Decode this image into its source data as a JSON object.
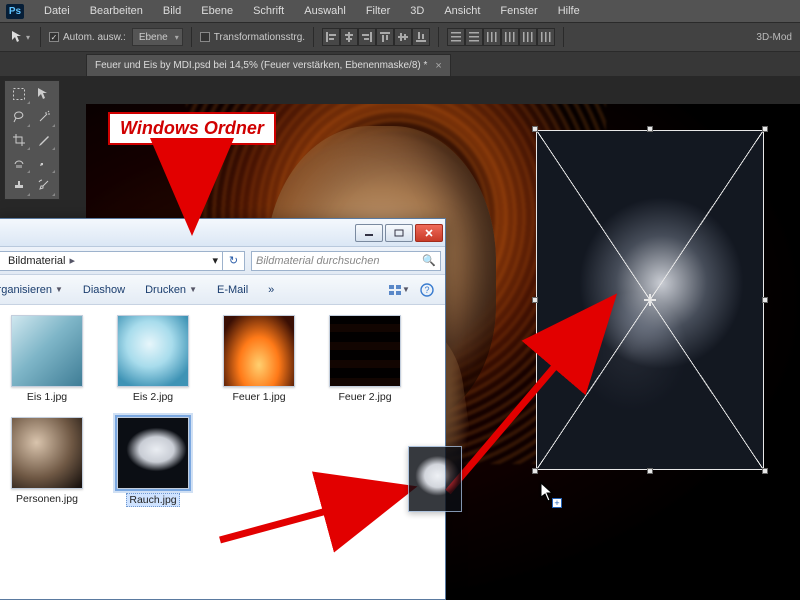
{
  "app": {
    "logo": "Ps"
  },
  "menus": [
    "Datei",
    "Bearbeiten",
    "Bild",
    "Ebene",
    "Schrift",
    "Auswahl",
    "Filter",
    "3D",
    "Ansicht",
    "Fenster",
    "Hilfe"
  ],
  "options": {
    "auto_select_label": "Autom. ausw.:",
    "auto_select_mode": "Ebene",
    "transform_controls_label": "Transformationsstrg.",
    "right_label": "3D-Mod"
  },
  "doc_tab": {
    "title": "Feuer und Eis by MDI.psd bei 14,5% (Feuer verstärken, Ebenenmaske/8) *"
  },
  "annotation": {
    "label": "Windows Ordner"
  },
  "explorer": {
    "folder": "Bildmaterial",
    "search_placeholder": "Bildmaterial durchsuchen",
    "toolbar": {
      "organize": "Organisieren",
      "slideshow": "Diashow",
      "print": "Drucken",
      "email": "E-Mail"
    },
    "files": [
      {
        "name": "Eis 1.jpg",
        "thumb": "th-ice1"
      },
      {
        "name": "Eis 2.jpg",
        "thumb": "th-ice2"
      },
      {
        "name": "Feuer 1.jpg",
        "thumb": "th-fire1"
      },
      {
        "name": "Feuer 2.jpg",
        "thumb": "th-fire2"
      },
      {
        "name": "Personen.jpg",
        "thumb": "th-pers"
      },
      {
        "name": "Rauch.jpg",
        "thumb": "th-smoke",
        "selected": true
      }
    ]
  }
}
